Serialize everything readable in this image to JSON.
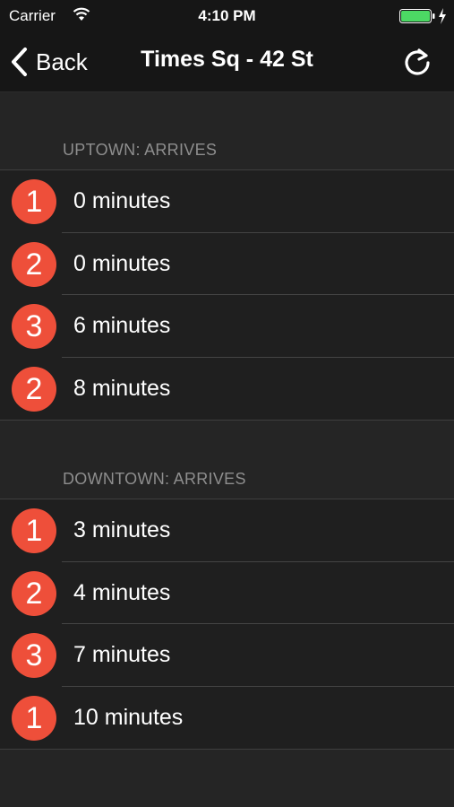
{
  "status_bar": {
    "carrier": "Carrier",
    "time": "4:10 PM",
    "icons": [
      "wifi-icon",
      "battery-icon",
      "charging-bolt-icon"
    ],
    "battery_color": "#4cd964"
  },
  "nav": {
    "back_label": "Back",
    "title": "Times Sq - 42 St",
    "refresh_icon": "refresh-icon"
  },
  "colors": {
    "badge": "#ee4f3a",
    "background": "#252525",
    "header_text": "#8e8e8e"
  },
  "uptown": {
    "header": "UPTOWN: ARRIVES",
    "rows": [
      {
        "line": "1",
        "time": "0 minutes"
      },
      {
        "line": "2",
        "time": "0 minutes"
      },
      {
        "line": "3",
        "time": "6 minutes"
      },
      {
        "line": "2",
        "time": "8 minutes"
      }
    ]
  },
  "downtown": {
    "header": "DOWNTOWN: ARRIVES",
    "rows": [
      {
        "line": "1",
        "time": "3 minutes"
      },
      {
        "line": "2",
        "time": "4 minutes"
      },
      {
        "line": "3",
        "time": "7 minutes"
      },
      {
        "line": "1",
        "time": "10 minutes"
      }
    ]
  }
}
